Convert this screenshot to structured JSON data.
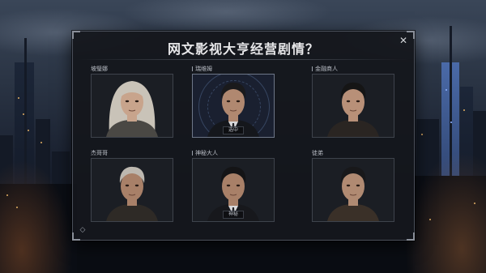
{
  "dialog": {
    "title": "网文影视大亨经营剧情？"
  },
  "icons": {
    "close": "close-icon",
    "settings": "settings-diamond-icon"
  },
  "characters": [
    {
      "label": "坡璧娜",
      "marker": false,
      "selected": false,
      "hair": "#c9c3b8",
      "skin": "#c8a48c",
      "coat": "#4a4844",
      "tag": ""
    },
    {
      "label": "瑞维姆",
      "marker": true,
      "selected": true,
      "hair": "#1a1a1c",
      "skin": "#b08870",
      "coat": "#15171c",
      "tag": "选中"
    },
    {
      "label": "金融商人",
      "marker": true,
      "selected": false,
      "hair": "#151515",
      "skin": "#b89078",
      "coat": "#2a2522",
      "tag": ""
    },
    {
      "label": "杰哥哥",
      "marker": false,
      "selected": false,
      "hair": "#bdb8b0",
      "skin": "#a88068",
      "coat": "#2e2a26",
      "tag": ""
    },
    {
      "label": "神秘大人",
      "marker": true,
      "selected": false,
      "hair": "#141416",
      "skin": "#a88068",
      "coat": "#17181c",
      "tag": "神秘"
    },
    {
      "label": "徒弟",
      "marker": false,
      "selected": false,
      "hair": "#18181a",
      "skin": "#b08a72",
      "coat": "#3a3028",
      "tag": ""
    }
  ]
}
